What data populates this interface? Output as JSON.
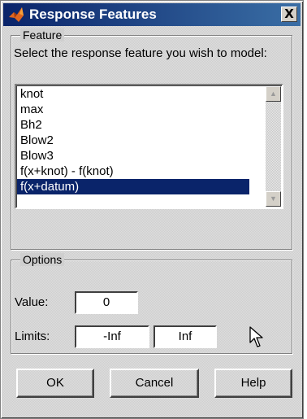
{
  "window": {
    "title": "Response Features",
    "icon": "matlab-icon",
    "close_label": "X"
  },
  "feature_group": {
    "title": "Feature",
    "prompt": "Select the response feature you wish to model:",
    "items": [
      {
        "label": "knot",
        "selected": false
      },
      {
        "label": "max",
        "selected": false
      },
      {
        "label": "Bh2",
        "selected": false
      },
      {
        "label": "Blow2",
        "selected": false
      },
      {
        "label": "Blow3",
        "selected": false
      },
      {
        "label": "f(x+knot) - f(knot)",
        "selected": false
      },
      {
        "label": "f(x+datum)",
        "selected": true
      }
    ]
  },
  "options_group": {
    "title": "Options",
    "value_label": "Value:",
    "value": "0",
    "limits_label": "Limits:",
    "limit_min": "-Inf",
    "limit_max": "Inf"
  },
  "buttons": {
    "ok": "OK",
    "cancel": "Cancel",
    "help": "Help"
  },
  "colors": {
    "title_start": "#0a246a",
    "title_end": "#3a6ea5",
    "selection": "#0a246a",
    "face": "#d4d0c8"
  }
}
